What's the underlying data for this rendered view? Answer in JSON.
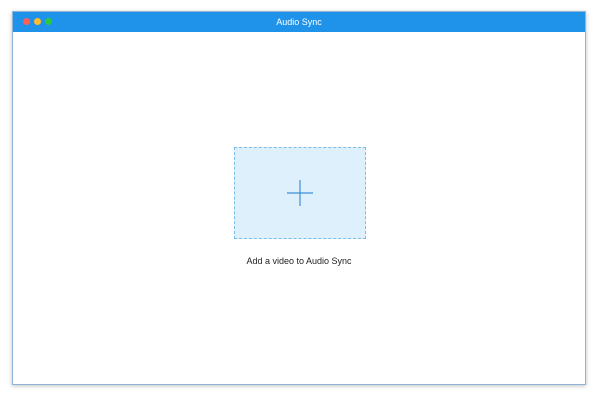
{
  "window": {
    "title": "Audio Sync",
    "controls": {
      "close_icon": "close-dot",
      "minimize_icon": "minimize-dot",
      "maximize_icon": "maximize-dot"
    }
  },
  "main": {
    "add_icon": "plus-icon",
    "caption": "Add a video to Audio Sync"
  },
  "colors": {
    "titlebar": "#1f93ea",
    "dropzone_fill": "#dff0fd",
    "dropzone_border": "#7bbde6",
    "plus": "#3d8fd6"
  }
}
